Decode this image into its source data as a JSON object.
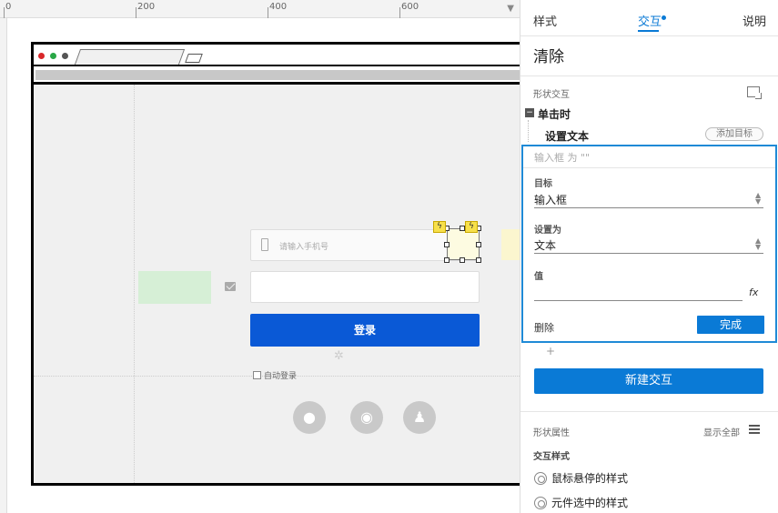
{
  "canvas": {
    "ruler": {
      "labels": [
        "0",
        "200",
        "400",
        "600"
      ]
    },
    "browser": {
      "traffic_lights": {
        "red": "#d9282a",
        "green": "#29a746",
        "gray": "#555555"
      }
    },
    "form": {
      "phone_placeholder": "请输入手机号",
      "login_label": "登录",
      "auto_login": "自动登录"
    },
    "social_icons": [
      "wechat-icon",
      "weibo-icon",
      "qq-icon"
    ]
  },
  "panel": {
    "tabs": [
      {
        "label": "样式",
        "active": false
      },
      {
        "label": "交互",
        "active": true
      },
      {
        "label": "说明",
        "active": false
      }
    ],
    "widget_name": "清除",
    "shape_interactions_label": "形状交互",
    "event_label": "单击时",
    "collapse_symbol": "−",
    "action_label": "设置文本",
    "add_target_label": "添加目标",
    "editor": {
      "summary": "输入框 为 \"\"",
      "target": {
        "label": "目标",
        "value": "输入框"
      },
      "set_to": {
        "label": "设置为",
        "value": "文本"
      },
      "value": {
        "label": "值",
        "value": ""
      },
      "fx_label": "fx",
      "delete_label": "删除",
      "done_label": "完成"
    },
    "plus_symbol": "+",
    "new_interaction_label": "新建交互",
    "shape_properties_label": "形状属性",
    "show_all_label": "显示全部",
    "interaction_styles_label": "交互样式",
    "style_items": [
      "鼠标悬停的样式",
      "元件选中的样式"
    ],
    "accent_color": "#0a7ad6"
  }
}
